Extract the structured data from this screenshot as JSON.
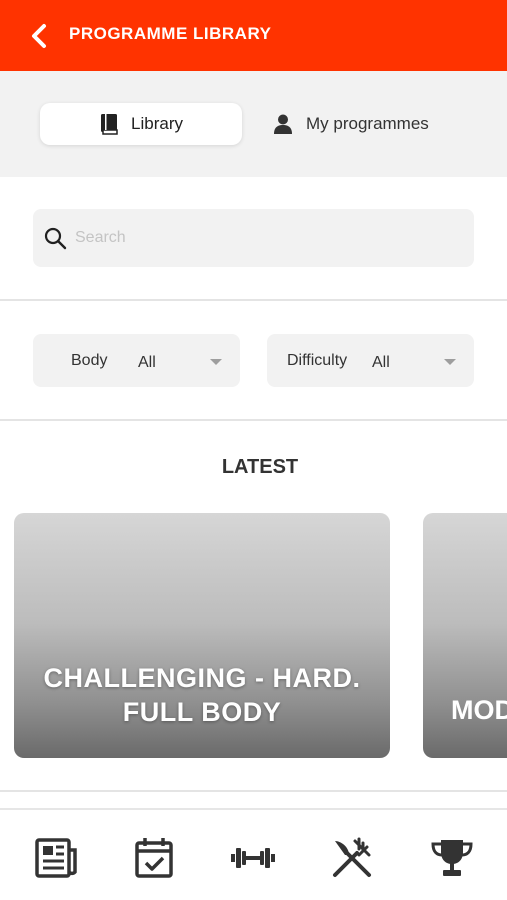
{
  "header": {
    "title": "PROGRAMME LIBRARY",
    "back_icon": "chevron-left-icon",
    "color": "#ff3300"
  },
  "tabs": {
    "library": {
      "label": "Library",
      "icon": "book-icon",
      "selected": true
    },
    "my_programmes": {
      "label": "My programmes",
      "icon": "person-icon",
      "selected": false
    }
  },
  "search": {
    "placeholder": "Search",
    "value": "",
    "icon": "search-icon"
  },
  "filters": {
    "body": {
      "label": "Body",
      "value": "All"
    },
    "difficulty": {
      "label": "Difficulty",
      "value": "All"
    }
  },
  "latest": {
    "title": "LATEST",
    "cards": [
      {
        "title_line1": "CHALLENGING - HARD.",
        "title_line2": "FULL BODY"
      },
      {
        "title_line1": "MOD"
      }
    ]
  },
  "bottom_nav": {
    "items": [
      "newspaper-icon",
      "calendar-check-icon",
      "dumbbell-icon",
      "fork-knife-icon",
      "trophy-icon"
    ],
    "selected": "dumbbell-icon"
  }
}
